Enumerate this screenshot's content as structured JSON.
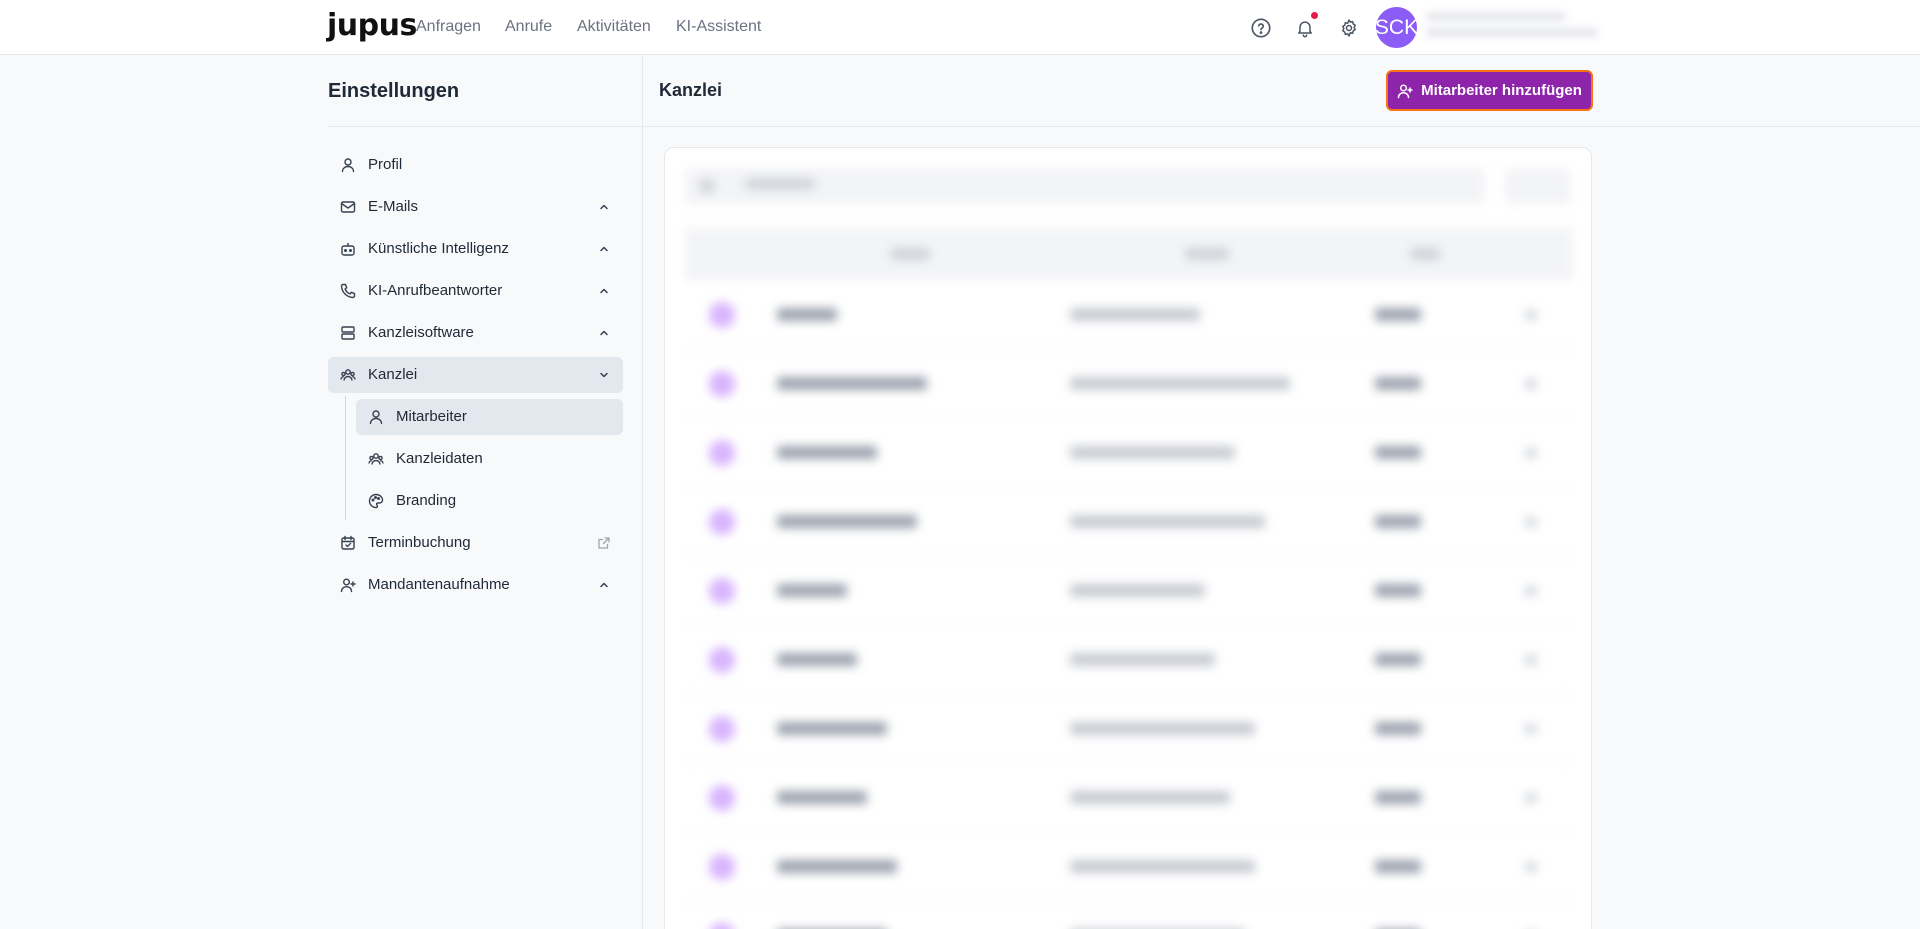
{
  "topnav": {
    "logo": "jupus",
    "items": [
      "Anfragen",
      "Anrufe",
      "Aktivitäten",
      "KI-Assistent"
    ],
    "avatar_initials": "SCK"
  },
  "sidebar": {
    "title": "Einstellungen",
    "items": [
      {
        "label": "Profil",
        "icon": "user-icon"
      },
      {
        "label": "E-Mails",
        "icon": "mail-icon"
      },
      {
        "label": "Künstliche Intelligenz",
        "icon": "bot-icon"
      },
      {
        "label": "KI-Anrufbeantworter",
        "icon": "phone-icon"
      },
      {
        "label": "Kanzleisoftware",
        "icon": "server-icon"
      },
      {
        "label": "Kanzlei",
        "icon": "building-icon"
      },
      {
        "label": "Terminbuchung",
        "icon": "calendar-icon"
      },
      {
        "label": "Mandantenaufnahme",
        "icon": "user-plus-icon"
      }
    ],
    "subitems": [
      {
        "label": "Mitarbeiter",
        "icon": "user-icon"
      },
      {
        "label": "Kanzleidaten",
        "icon": "building-icon"
      },
      {
        "label": "Branding",
        "icon": "palette-icon"
      }
    ]
  },
  "main": {
    "title": "Kanzlei",
    "add_button_label": "Mitarbeiter hinzufügen"
  },
  "colors": {
    "accent": "#8e24aa",
    "avatar": "#8b5cf6",
    "notification": "#e11d48"
  }
}
